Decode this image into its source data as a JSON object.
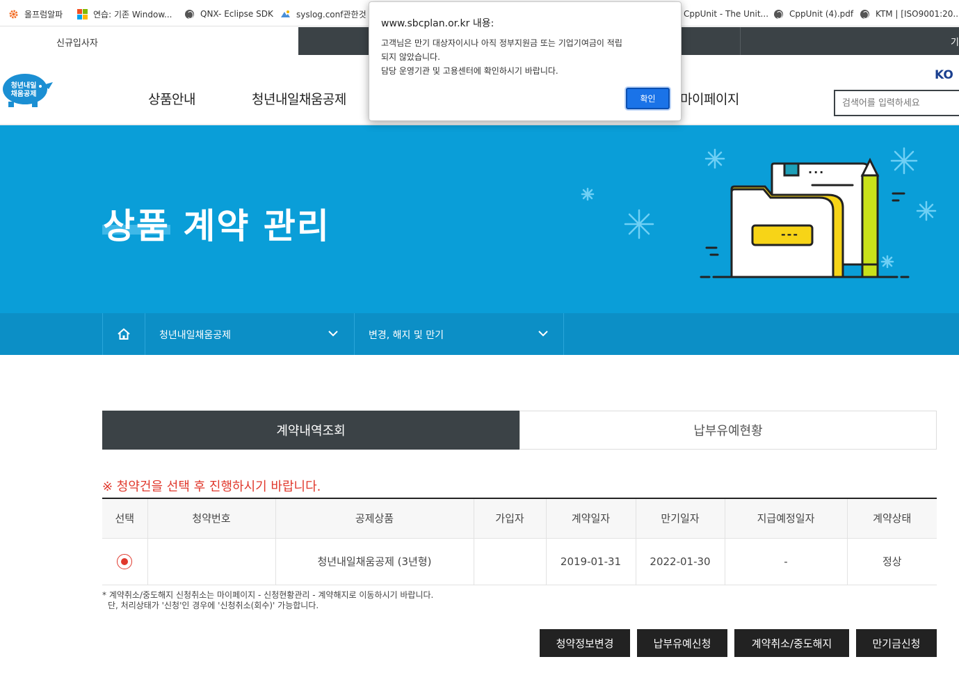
{
  "bookmarks": [
    {
      "icon": "gear-orange-icon",
      "label": "올프럼알파"
    },
    {
      "icon": "windows-logo-icon",
      "label": "연습: 기존 Window..."
    },
    {
      "icon": "globe-icon",
      "label": "QNX- Eclipse SDK"
    },
    {
      "icon": "page-icon",
      "label": "syslog.conf관한것"
    },
    {
      "icon": "globe-icon",
      "label": "CppUnit - The Unit..."
    },
    {
      "icon": "globe-icon",
      "label": "CppUnit (4).pdf"
    },
    {
      "icon": "globe-icon",
      "label": "KTM | [ISO9001:20..."
    }
  ],
  "top_strip": {
    "left_label": "신규입사자",
    "right_cut_label": "기"
  },
  "header": {
    "logo_text": "청년내일 채움공제",
    "nav": [
      "상품안내",
      "청년내일채움공제",
      "마이페이지"
    ],
    "search_placeholder": "검색어를 입력하세요",
    "brand_cut": "KO"
  },
  "hero": {
    "title": "상품 계약 관리",
    "card_dots": "---",
    "note_dots": "..."
  },
  "location": {
    "home_icon": "home-icon",
    "level1": "청년내일채움공제",
    "level2": "변경, 해지 및 만기"
  },
  "tabs": [
    {
      "label": "계약내역조회",
      "active": true
    },
    {
      "label": "납부유예현황",
      "active": false
    }
  ],
  "notice": "※ 청약건을 선택 후 진행하시기 바랍니다.",
  "table": {
    "headers": [
      "선택",
      "청약번호",
      "공제상품",
      "가입자",
      "계약일자",
      "만기일자",
      "지급예정일자",
      "계약상태"
    ],
    "rows": [
      {
        "selected": true,
        "number": "",
        "product": "청년내일채움공제 (3년형)",
        "subscriber": "",
        "contract_date": "2019-01-31",
        "maturity_date": "2022-01-30",
        "payment_date": "-",
        "status": "정상"
      }
    ]
  },
  "notes": [
    "* 계약취소/중도해지 신청취소는 마이페이지 - 신청현황관리 - 계약해지로 이동하시기 바랍니다.",
    "단, 처리상태가 '신청'인 경우에 '신청취소(회수)' 가능합니다."
  ],
  "buttons": [
    "청약정보변경",
    "납부유예신청",
    "계약취소/중도해지",
    "만기금신청"
  ],
  "dialog": {
    "title": "www.sbcplan.or.kr 내용:",
    "lines": [
      "고객님은 만기 대상자이시나 아직 정부지원금 또는 기업기여금이 적립",
      "되지 않았습니다.",
      "담당 운영기관 및 고용센터에 확인하시기 바랍니다."
    ],
    "ok_label": "확인"
  },
  "colors": {
    "hero_bg": "#0a9ed8",
    "locbar_bg": "#0c8fc6",
    "dark": "#3b4246",
    "accent_red": "#e0382c",
    "dialog_button": "#1a73e8"
  }
}
